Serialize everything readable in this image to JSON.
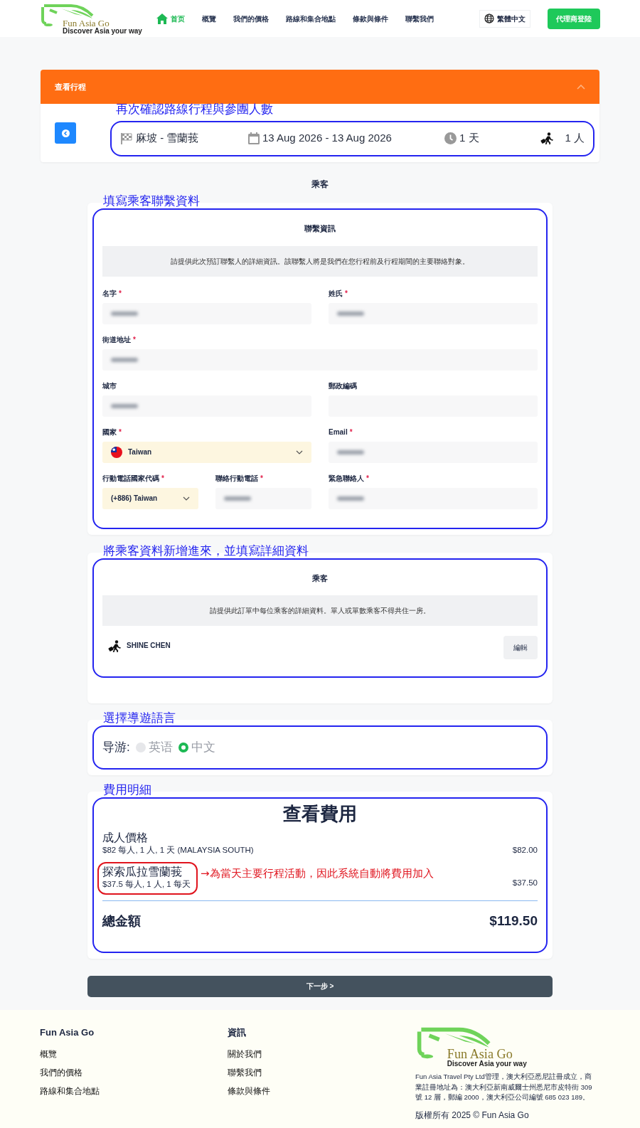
{
  "header": {
    "logo": {
      "name": "Fun Asia Go",
      "tagline": "Discover Asia your way"
    },
    "nav": [
      {
        "label": "首页",
        "selected": true
      },
      {
        "label": "概覽",
        "selected": false
      },
      {
        "label": "我們的價格",
        "selected": false
      },
      {
        "label": "路線和集合地點",
        "selected": false
      },
      {
        "label": "條款與條件",
        "selected": false
      },
      {
        "label": "聯繫我們",
        "selected": false
      }
    ],
    "language": "繁體中文",
    "agent_login": "代理商登陸"
  },
  "itinerary": {
    "title": "查看行程",
    "expanded": true,
    "annotation": "再次確認路線行程與參團人數",
    "route": "麻坡 - 雪蘭莪",
    "dates": "13 Aug 2026 - 13 Aug 2026",
    "duration": "1 天",
    "people": "1 人"
  },
  "passengers_heading": "乘客",
  "contact": {
    "annotation": "填寫乘客聯繫資料",
    "title": "聯繫資訊",
    "notice": "請提供此次預訂聯繫人的詳細資訊。該聯繫人將是我們在您行程前及行程期間的主要聯絡對象。",
    "rows": [
      [
        {
          "kind": "text",
          "label": "名字",
          "asterisk": "*",
          "redacted": true
        },
        {
          "kind": "text",
          "label": "姓氏",
          "asterisk": "*",
          "redacted": true
        }
      ],
      [
        {
          "kind": "text",
          "label": "街道地址",
          "asterisk": "*",
          "redacted": true
        }
      ],
      [
        {
          "kind": "text",
          "label": "城市",
          "redacted": true
        },
        {
          "kind": "text",
          "label": "郵政編碼",
          "redacted": false
        }
      ],
      [
        {
          "kind": "select",
          "label": "國家",
          "asterisk": "*",
          "value": "Taiwan",
          "flag": true
        },
        {
          "kind": "text",
          "label": "Email",
          "asterisk": "*",
          "redacted": true
        }
      ],
      [
        {
          "kind": "select",
          "label": "行動電話國家代碼",
          "asterisk": "*",
          "value": "(+886) Taiwan",
          "flag": false
        },
        {
          "kind": "text",
          "label": "聯絡行動電話",
          "asterisk": "*",
          "redacted": true
        },
        {
          "kind": "text",
          "label": "緊急聯絡人",
          "asterisk": "*",
          "redacted": true
        }
      ]
    ]
  },
  "passengers": {
    "annotation": "將乘客資料新增進來，並填寫詳細資料",
    "title": "乘客",
    "notice": "請提供此訂單中每位乘客的詳細資料。單人或單數乘客不得共住一房。",
    "list": [
      {
        "name": "SHINE CHEN",
        "edit": "編輯"
      }
    ]
  },
  "guide": {
    "annotation": "選擇導遊語言",
    "label": "导游:",
    "options": [
      {
        "label": "英语",
        "selected": false
      },
      {
        "label": "中文",
        "selected": true
      }
    ]
  },
  "costs": {
    "annotation": "費用明細",
    "title": "查看費用",
    "items": [
      {
        "name": "成人價格",
        "detail": "$82 每人, 1 人, 1 天 (MALAYSIA SOUTH)",
        "amount": "$82.00",
        "circled": false
      },
      {
        "name": "探索瓜拉雪蘭莪",
        "detail": "$37.5 每人, 1 人, 1 每天",
        "amount": "$37.50",
        "circled": true,
        "note": "→為當天主要行程活動，因此系統自動將費用加入"
      }
    ],
    "total_label": "總金額",
    "total": "$119.50"
  },
  "next_button": "下一步 >",
  "footer": {
    "columns": [
      {
        "title": "Fun Asia Go",
        "links": [
          "概覽",
          "我們的價格",
          "路線和集合地點"
        ]
      },
      {
        "title": "資訊",
        "links": [
          "關於我們",
          "聯繫我們",
          "條款與條件"
        ]
      }
    ],
    "logo": {
      "name": "Fun Asia Go",
      "tagline": "Discover Asia your way"
    },
    "description": "Fun Asia Travel Pty Ltd管理，澳大利亞悉尼註冊成立，商業註冊地址為：澳大利亞新南威爾士州悉尼市皮特街 309 號 12 層，郵編 2000，澳大利亞公司編號 685 023 189。",
    "copyright": "版權所有 2025 © Fun Asia Go"
  }
}
